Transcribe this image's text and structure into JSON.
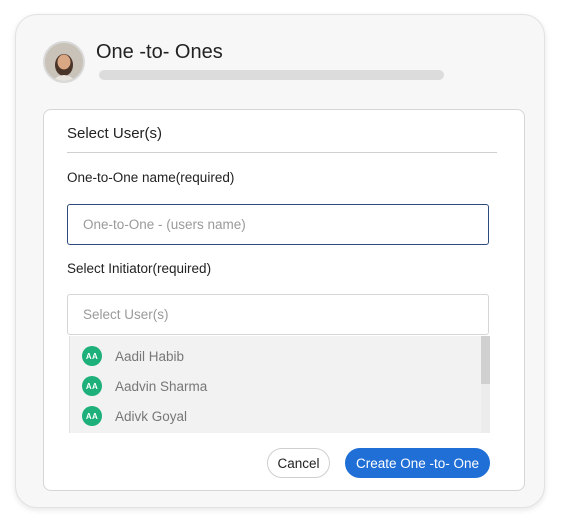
{
  "header": {
    "title": "One -to- Ones",
    "avatar_icon": "user-profile-photo"
  },
  "panel": {
    "heading": "Select User(s)",
    "name_field": {
      "label": "One-to-One name(required)",
      "value": "",
      "placeholder": "One-to-One - (users name)"
    },
    "initiator_field": {
      "label": "Select Initiator(required)",
      "value": "",
      "placeholder": "Select User(s)"
    },
    "users": [
      {
        "initials": "AA",
        "name": "Aadil Habib"
      },
      {
        "initials": "AA",
        "name": "Aadvin Sharma"
      },
      {
        "initials": "AA",
        "name": "Adivk Goyal"
      }
    ]
  },
  "actions": {
    "cancel_label": "Cancel",
    "create_label": "Create One -to- One"
  },
  "colors": {
    "accent": "#1f6fd6",
    "initials_badge": "#1db07a",
    "focused_border": "#2c4b7c"
  }
}
